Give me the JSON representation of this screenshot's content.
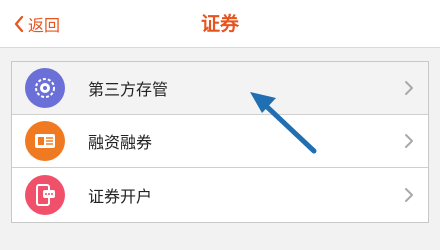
{
  "header": {
    "back_label": "返回",
    "title": "证券"
  },
  "menu": {
    "items": [
      {
        "label": "第三方存管",
        "icon": "coin-transfer-icon",
        "icon_color": "#6b6fd8"
      },
      {
        "label": "融资融券",
        "icon": "margin-ticket-icon",
        "icon_color": "#f07a22"
      },
      {
        "label": "证券开户",
        "icon": "phone-chat-icon",
        "icon_color": "#f0506a"
      }
    ]
  },
  "colors": {
    "accent": "#e8541e",
    "annotation_arrow": "#1f6fb2"
  }
}
